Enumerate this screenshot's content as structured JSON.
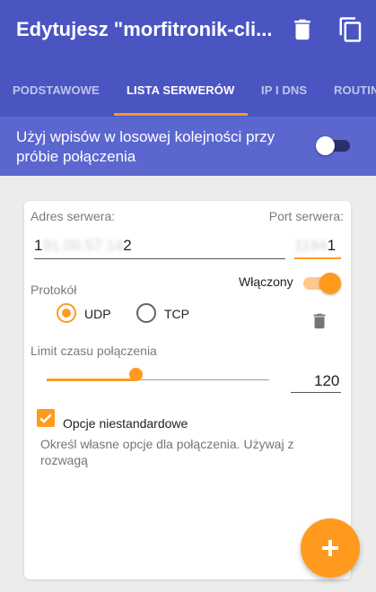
{
  "app_bar": {
    "title": "Edytujesz \"morfitronik-cli...",
    "actions": [
      "delete-icon",
      "copy-icon"
    ]
  },
  "tabs": [
    {
      "label": "PODSTAWOWE",
      "active": false
    },
    {
      "label": "LISTA SERWERÓW",
      "active": true
    },
    {
      "label": "IP I DNS",
      "active": false
    },
    {
      "label": "ROUTING",
      "active": false
    }
  ],
  "random_order": {
    "label": "Użyj wpisów w losowej kolejności przy próbie połączenia",
    "enabled": false
  },
  "server": {
    "address_label": "Adres serwera:",
    "address_prefix": "1",
    "address_masked": "91.00.57.14",
    "address_suffix": "2",
    "port_label": "Port serwera:",
    "port_masked": "1194",
    "port_suffix": "1",
    "enabled_label": "Włączony",
    "enabled": true,
    "protocol_label": "Protokół",
    "protocols": [
      {
        "label": "UDP",
        "selected": true
      },
      {
        "label": "TCP",
        "selected": false
      }
    ],
    "timeout_label": "Limit czasu połączenia",
    "timeout_value": "120",
    "timeout_slider_fraction": 0.35,
    "custom_options_label": "Opcje niestandardowe",
    "custom_options_checked": true,
    "custom_options_desc": "Określ własne opcje dla połączenia. Używaj z rozwagą"
  },
  "fab": {
    "icon": "add-icon"
  },
  "colors": {
    "primary": "#4a55c2",
    "accent": "#ff9a1f",
    "banner": "#5b67cf"
  }
}
